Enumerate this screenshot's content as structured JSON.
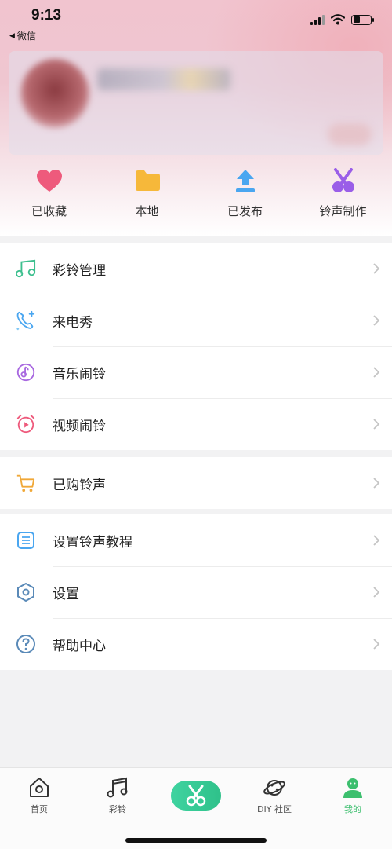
{
  "status": {
    "time": "9:13",
    "back_label": "微信"
  },
  "quick_actions": [
    {
      "label": "已收藏",
      "icon": "heart-icon",
      "color": "#ee5a7c"
    },
    {
      "label": "本地",
      "icon": "folder-icon",
      "color": "#f6b83a"
    },
    {
      "label": "已发布",
      "icon": "upload-icon",
      "color": "#4aa6f0"
    },
    {
      "label": "铃声制作",
      "icon": "scissors-icon",
      "color": "#9a5ee8"
    }
  ],
  "menu_group_1": [
    {
      "label": "彩铃管理",
      "icon": "music-note-icon"
    },
    {
      "label": "来电秀",
      "icon": "phone-sparkle-icon"
    },
    {
      "label": "音乐闹铃",
      "icon": "music-alarm-icon"
    },
    {
      "label": "视频闹铃",
      "icon": "video-alarm-icon"
    }
  ],
  "menu_group_2": [
    {
      "label": "已购铃声",
      "icon": "shopping-cart-icon"
    }
  ],
  "menu_group_3": [
    {
      "label": "设置铃声教程",
      "icon": "tutorial-list-icon"
    },
    {
      "label": "设置",
      "icon": "settings-hexagon-icon"
    },
    {
      "label": "帮助中心",
      "icon": "help-circle-icon"
    }
  ],
  "tabbar": {
    "items": [
      {
        "label": "首页",
        "icon": "home-icon"
      },
      {
        "label": "彩铃",
        "icon": "music-notes-icon"
      },
      {
        "label": "DIY 社区",
        "icon": "planet-icon"
      },
      {
        "label": "我的",
        "icon": "user-icon"
      }
    ],
    "center_icon": "scissors-icon",
    "active_color": "#3cbf6e"
  }
}
